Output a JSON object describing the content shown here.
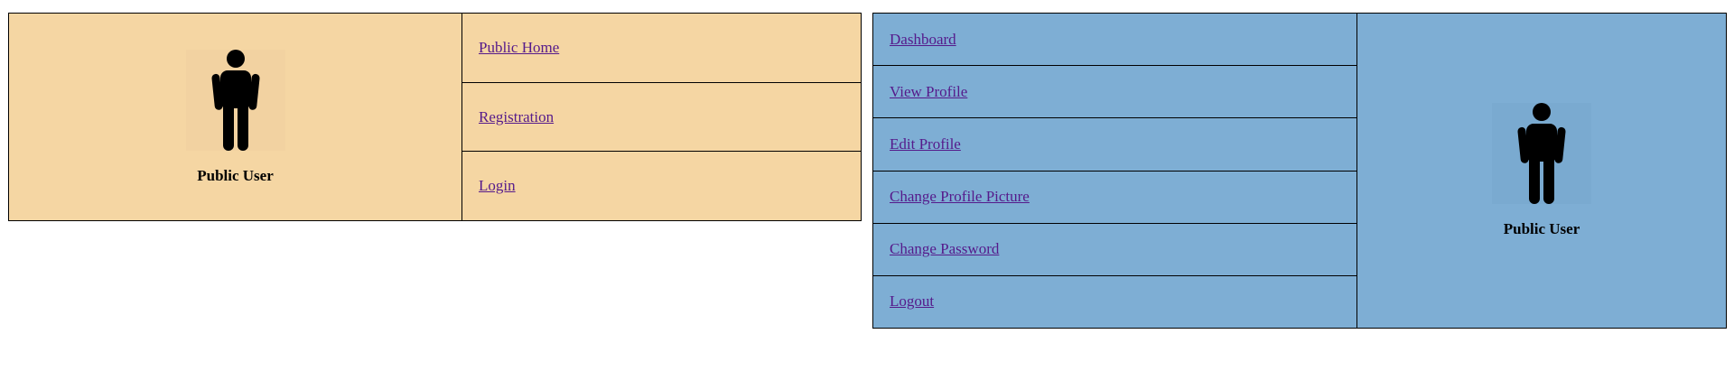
{
  "public_panel": {
    "user_name": "Public User",
    "links": [
      {
        "label": "Public Home"
      },
      {
        "label": "Registration"
      },
      {
        "label": "Login"
      }
    ]
  },
  "user_panel": {
    "user_name": "Public User",
    "links": [
      {
        "label": "Dashboard"
      },
      {
        "label": "View Profile"
      },
      {
        "label": "Edit Profile"
      },
      {
        "label": "Change Profile Picture"
      },
      {
        "label": "Change Password"
      },
      {
        "label": "Logout"
      }
    ]
  },
  "colors": {
    "public_panel_bg": "#f5d6a3",
    "user_panel_bg": "#7eaed4",
    "link": "#551a8b"
  },
  "icons": {
    "avatar": "person-icon"
  }
}
